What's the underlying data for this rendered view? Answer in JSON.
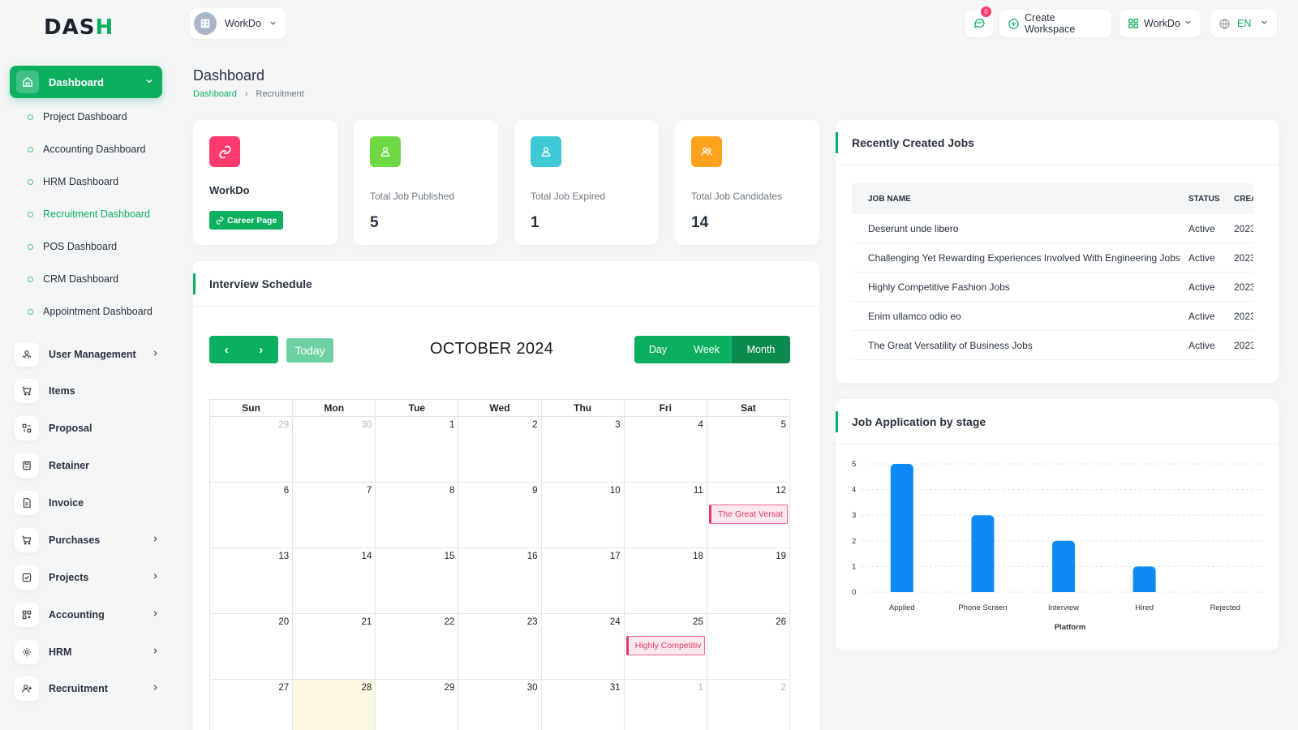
{
  "logo": {
    "text_main": "DAS",
    "text_accent": "H"
  },
  "sidebar": {
    "main": {
      "label": "Dashboard"
    },
    "sub_items": [
      {
        "label": "Project Dashboard",
        "active": false
      },
      {
        "label": "Accounting Dashboard",
        "active": false
      },
      {
        "label": "HRM Dashboard",
        "active": false
      },
      {
        "label": "Recruitment Dashboard",
        "active": true
      },
      {
        "label": "POS Dashboard",
        "active": false
      },
      {
        "label": "CRM Dashboard",
        "active": false
      },
      {
        "label": "Appointment Dashboard",
        "active": false
      }
    ],
    "items": [
      {
        "label": "User Management",
        "icon": "users-icon",
        "chevron": true
      },
      {
        "label": "Items",
        "icon": "cart-icon",
        "chevron": false
      },
      {
        "label": "Proposal",
        "icon": "proposal-icon",
        "chevron": false
      },
      {
        "label": "Retainer",
        "icon": "retainer-icon",
        "chevron": false
      },
      {
        "label": "Invoice",
        "icon": "invoice-icon",
        "chevron": false
      },
      {
        "label": "Purchases",
        "icon": "cart-icon",
        "chevron": true
      },
      {
        "label": "Projects",
        "icon": "projects-icon",
        "chevron": true
      },
      {
        "label": "Accounting",
        "icon": "grid-icon",
        "chevron": true
      },
      {
        "label": "HRM",
        "icon": "hrm-icon",
        "chevron": true
      },
      {
        "label": "Recruitment",
        "icon": "user-add-icon",
        "chevron": true
      }
    ]
  },
  "header": {
    "workspace": "WorkDo",
    "notifications_count": "0",
    "create_workspace": "Create Workspace",
    "workspace_menu": "WorkDo",
    "language": "EN"
  },
  "page": {
    "title": "Dashboard",
    "breadcrumb": [
      "Dashboard",
      "Recruitment"
    ]
  },
  "stats": {
    "company": {
      "name": "WorkDo",
      "career_button": "Career Page"
    },
    "cards": [
      {
        "title": "Total Job Published",
        "value": "5",
        "color": "#6fd943"
      },
      {
        "title": "Total Job Expired",
        "value": "1",
        "color": "#3ec9d6"
      },
      {
        "title": "Total Job Candidates",
        "value": "14",
        "color": "#ffa21d"
      }
    ],
    "company_color": "#ff3a6e"
  },
  "interview": {
    "title": "Interview Schedule",
    "today_label": "Today",
    "month_title": "OCTOBER 2024",
    "views": [
      "Day",
      "Week",
      "Month"
    ],
    "active_view": "Month",
    "weekdays": [
      "Sun",
      "Mon",
      "Tue",
      "Wed",
      "Thu",
      "Fri",
      "Sat"
    ],
    "weeks": [
      [
        "29",
        "30",
        "1",
        "2",
        "3",
        "4",
        "5"
      ],
      [
        "6",
        "7",
        "8",
        "9",
        "10",
        "11",
        "12"
      ],
      [
        "13",
        "14",
        "15",
        "16",
        "17",
        "18",
        "19"
      ],
      [
        "20",
        "21",
        "22",
        "23",
        "24",
        "25",
        "26"
      ],
      [
        "27",
        "28",
        "29",
        "30",
        "31",
        "1",
        "2"
      ]
    ],
    "events": [
      {
        "week": 1,
        "day": 6,
        "label": "The Great Versat"
      },
      {
        "week": 3,
        "day": 5,
        "label": "Highly Competitiv"
      }
    ],
    "today_cell": {
      "week": 4,
      "day": 1
    }
  },
  "recent_jobs": {
    "title": "Recently Created Jobs",
    "columns": [
      "JOB NAME",
      "STATUS",
      "CREA"
    ],
    "rows": [
      {
        "name": "Deserunt unde libero",
        "status": "Active",
        "created": "2023"
      },
      {
        "name": "Challenging Yet Rewarding Experiences Involved With Engineering Jobs",
        "status": "Active",
        "created": "2023"
      },
      {
        "name": "Highly Competitive Fashion Jobs",
        "status": "Active",
        "created": "2023"
      },
      {
        "name": "Enim ullamco odio eo",
        "status": "Active",
        "created": "2023"
      },
      {
        "name": "The Great Versatility of Business Jobs",
        "status": "Active",
        "created": "2023"
      }
    ]
  },
  "chart_data": {
    "type": "bar",
    "title": "Job Application by stage",
    "xlabel": "Platform",
    "ylabel": "",
    "categories": [
      "Applied",
      "Phone Screen",
      "Interview",
      "Hired",
      "Rejected"
    ],
    "values": [
      5,
      3,
      2,
      1,
      0
    ],
    "ylim": [
      0,
      5
    ],
    "yticks": [
      0,
      1,
      2,
      3,
      4,
      5
    ],
    "color": "#0d8af5",
    "grid": true
  }
}
